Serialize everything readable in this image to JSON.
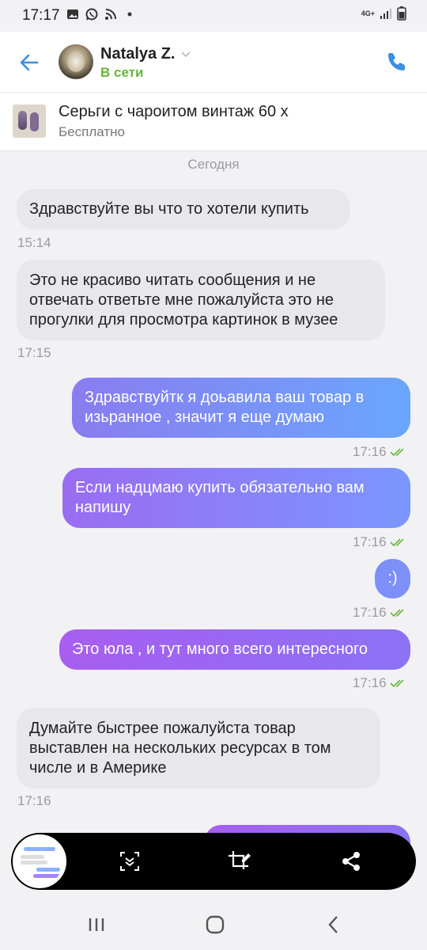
{
  "status_bar": {
    "time": "17:17",
    "network": "4G+",
    "icons": [
      "gallery-icon",
      "whatsapp-icon",
      "rss-icon",
      "dot-icon",
      "signal-icon",
      "battery-icon"
    ]
  },
  "header": {
    "contact_name": "Natalya Z.",
    "status": "В сети",
    "status_color": "#67b53a"
  },
  "product": {
    "title": "Серьги с чароитом винтаж 60 х",
    "price": "Бесплатно"
  },
  "chat": {
    "date_separator": "Сегодня",
    "messages": [
      {
        "direction": "in",
        "text": "Здравствуйте вы что то хотели купить",
        "time": "15:14"
      },
      {
        "direction": "in",
        "text": "Это не красиво читать сообщения и не отвечать ответьте мне пожалуйста это не прогулки для просмотра картинок в музее",
        "time": "17:15"
      },
      {
        "direction": "out",
        "text": "Здравствуйтк я доьавила ваш товар в изьранное , значит я еще думаю",
        "time": "17:16",
        "read": true
      },
      {
        "direction": "out",
        "text": "Если надцмаю купить обязательно вам напишу",
        "time": "17:16",
        "read": true
      },
      {
        "direction": "out",
        "text": ":)",
        "time": "17:16",
        "read": true
      },
      {
        "direction": "out",
        "text": "Это юла , и тут много всего интересного",
        "time": "17:16",
        "read": true
      },
      {
        "direction": "in",
        "text": "Думайте быстрее пожалуйста товар выставлен на нескольких ресурсах в том числе и в Америке",
        "time": "17:16"
      }
    ]
  },
  "colors": {
    "accent": "#3b8fe0",
    "incoming_bubble": "#e8e8ec",
    "outgoing_gradient_blue": "#6aa6ff",
    "outgoing_gradient_purple": "#9a6cf2",
    "read_check": "#67b53a"
  },
  "screenshot_toolbar": {
    "buttons": [
      "scroll-capture-icon",
      "crop-edit-icon",
      "share-icon"
    ]
  },
  "nav_bar": {
    "buttons": [
      "recent-apps-icon",
      "home-icon",
      "back-nav-icon"
    ]
  }
}
